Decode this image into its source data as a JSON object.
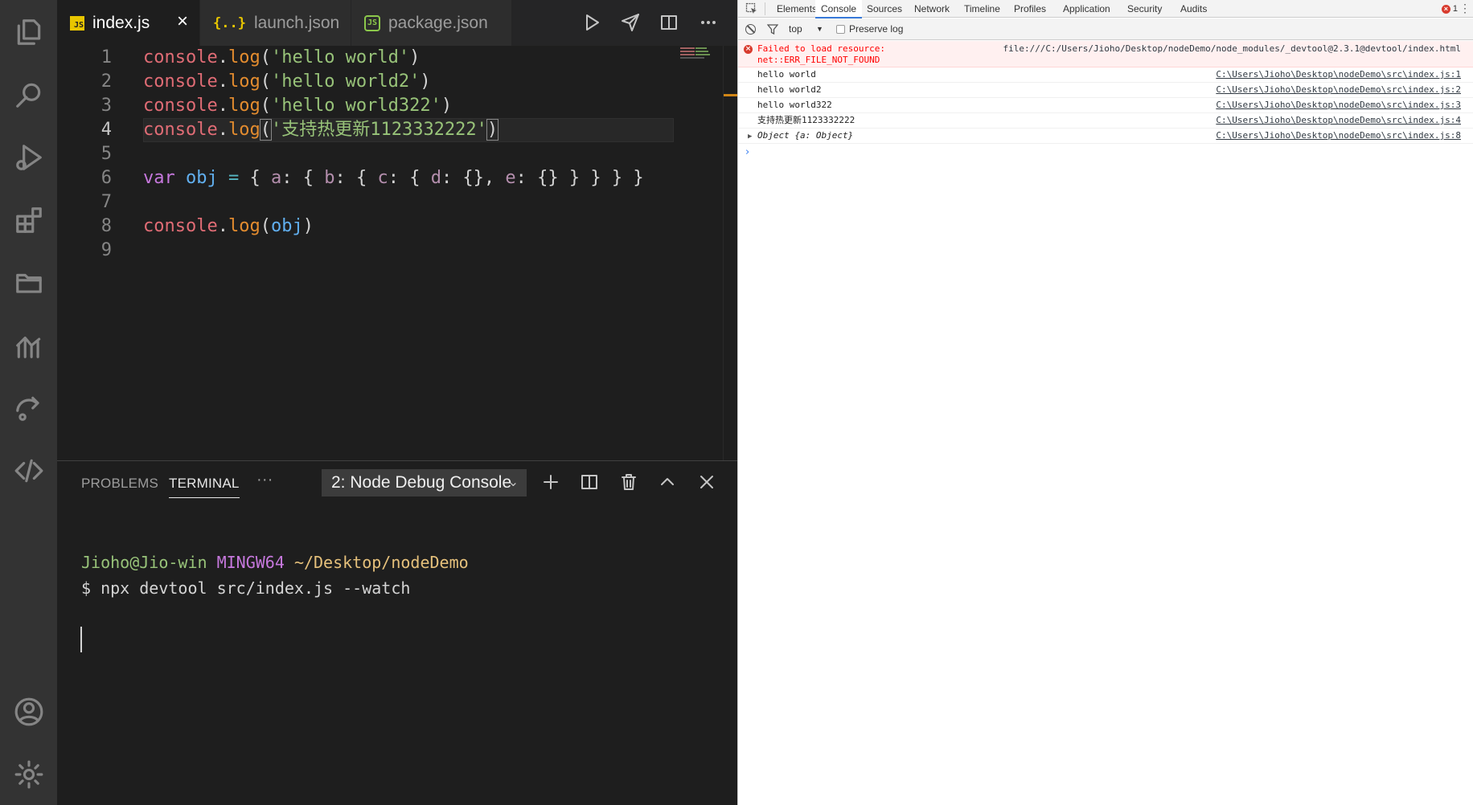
{
  "editor_tabs": [
    {
      "label": "index.js",
      "icon": "js-file-icon",
      "badge": "JS",
      "active": true
    },
    {
      "label": "launch.json",
      "icon": "json-file-icon",
      "badge": "{..}",
      "active": false
    },
    {
      "label": "package.json",
      "icon": "node-file-icon",
      "badge": "JS",
      "active": false
    }
  ],
  "activity_icons": [
    "explorer-icon",
    "search-icon",
    "run-debug-icon",
    "extensions-icon",
    "folder-icon",
    "charts-icon",
    "remote-icon",
    "code-icon",
    "account-icon",
    "settings-icon"
  ],
  "code": {
    "line_numbers": [
      "1",
      "2",
      "3",
      "4",
      "5",
      "6",
      "7",
      "8",
      "9"
    ],
    "current_line": 4,
    "lines": [
      [
        [
          "k-fn",
          "console"
        ],
        [
          "k-p",
          "."
        ],
        [
          "k-m",
          "log"
        ],
        [
          "k-p",
          "("
        ],
        [
          "k-str",
          "'hello world'"
        ],
        [
          "k-p",
          ")"
        ]
      ],
      [
        [
          "k-fn",
          "console"
        ],
        [
          "k-p",
          "."
        ],
        [
          "k-m",
          "log"
        ],
        [
          "k-p",
          "("
        ],
        [
          "k-str",
          "'hello world2'"
        ],
        [
          "k-p",
          ")"
        ]
      ],
      [
        [
          "k-fn",
          "console"
        ],
        [
          "k-p",
          "."
        ],
        [
          "k-m",
          "log"
        ],
        [
          "k-p",
          "("
        ],
        [
          "k-str",
          "'hello world322'"
        ],
        [
          "k-p",
          ")"
        ]
      ],
      [
        [
          "k-fn",
          "console"
        ],
        [
          "k-p",
          "."
        ],
        [
          "k-m",
          "log"
        ],
        [
          "k-p bracket-box",
          "("
        ],
        [
          "k-str",
          "'支持热更新1123332222'"
        ],
        [
          "k-p bracket-box",
          ")"
        ]
      ],
      [],
      [
        [
          "k-var",
          "var "
        ],
        [
          "k-id",
          "obj"
        ],
        [
          "k-op",
          " = "
        ],
        [
          "k-p",
          "{ "
        ],
        [
          "k-prop",
          "a"
        ],
        [
          "k-p",
          ": { "
        ],
        [
          "k-prop",
          "b"
        ],
        [
          "k-p",
          ": { "
        ],
        [
          "k-prop",
          "c"
        ],
        [
          "k-p",
          ": { "
        ],
        [
          "k-prop",
          "d"
        ],
        [
          "k-p",
          ": {}, "
        ],
        [
          "k-prop",
          "e"
        ],
        [
          "k-p",
          ": {} } } } }"
        ]
      ],
      [],
      [
        [
          "k-fn",
          "console"
        ],
        [
          "k-p",
          "."
        ],
        [
          "k-m",
          "log"
        ],
        [
          "k-p",
          "("
        ],
        [
          "k-id",
          "obj"
        ],
        [
          "k-p",
          ")"
        ]
      ],
      []
    ]
  },
  "panel": {
    "tabs": [
      "PROBLEMS",
      "TERMINAL"
    ],
    "active_tab": "TERMINAL",
    "more": "···",
    "terminal_select": "2: Node Debug Console",
    "terminal": {
      "user": "Jioho@Jio-win",
      "host": "MINGW64",
      "path": "~/Desktop/nodeDemo",
      "command": "$ npx devtool src/index.js --watch"
    }
  },
  "devtools": {
    "tabs": [
      "Elements",
      "Console",
      "Sources",
      "Network",
      "Timeline",
      "Profiles",
      "Application",
      "Security",
      "Audits"
    ],
    "active_tab": "Console",
    "error_count": "1",
    "more": "⋮",
    "context": "top",
    "preserve_log": "Preserve log",
    "error": {
      "line1": "Failed to load resource:",
      "line2": "net::ERR_FILE_NOT_FOUND",
      "source": "file:///C:/Users/Jioho/Desktop/nodeDemo/node_modules/_devtool@2.3.1@devtool/index.html"
    },
    "logs": [
      {
        "text": "hello world",
        "source": "C:\\Users\\Jioho\\Desktop\\nodeDemo\\src\\index.js:1"
      },
      {
        "text": "hello world2",
        "source": "C:\\Users\\Jioho\\Desktop\\nodeDemo\\src\\index.js:2"
      },
      {
        "text": "hello world322",
        "source": "C:\\Users\\Jioho\\Desktop\\nodeDemo\\src\\index.js:3"
      },
      {
        "text": "支持热更新1123332222",
        "source": "C:\\Users\\Jioho\\Desktop\\nodeDemo\\src\\index.js:4"
      }
    ],
    "object_log": {
      "text": "Object {a: Object}",
      "source": "C:\\Users\\Jioho\\Desktop\\nodeDemo\\src\\index.js:8"
    },
    "prompt": "›"
  },
  "colors": {
    "accent": "#3879d9",
    "error": "#d83b2e",
    "activity_bg": "#333333",
    "editor_bg": "#1e1e1e"
  }
}
